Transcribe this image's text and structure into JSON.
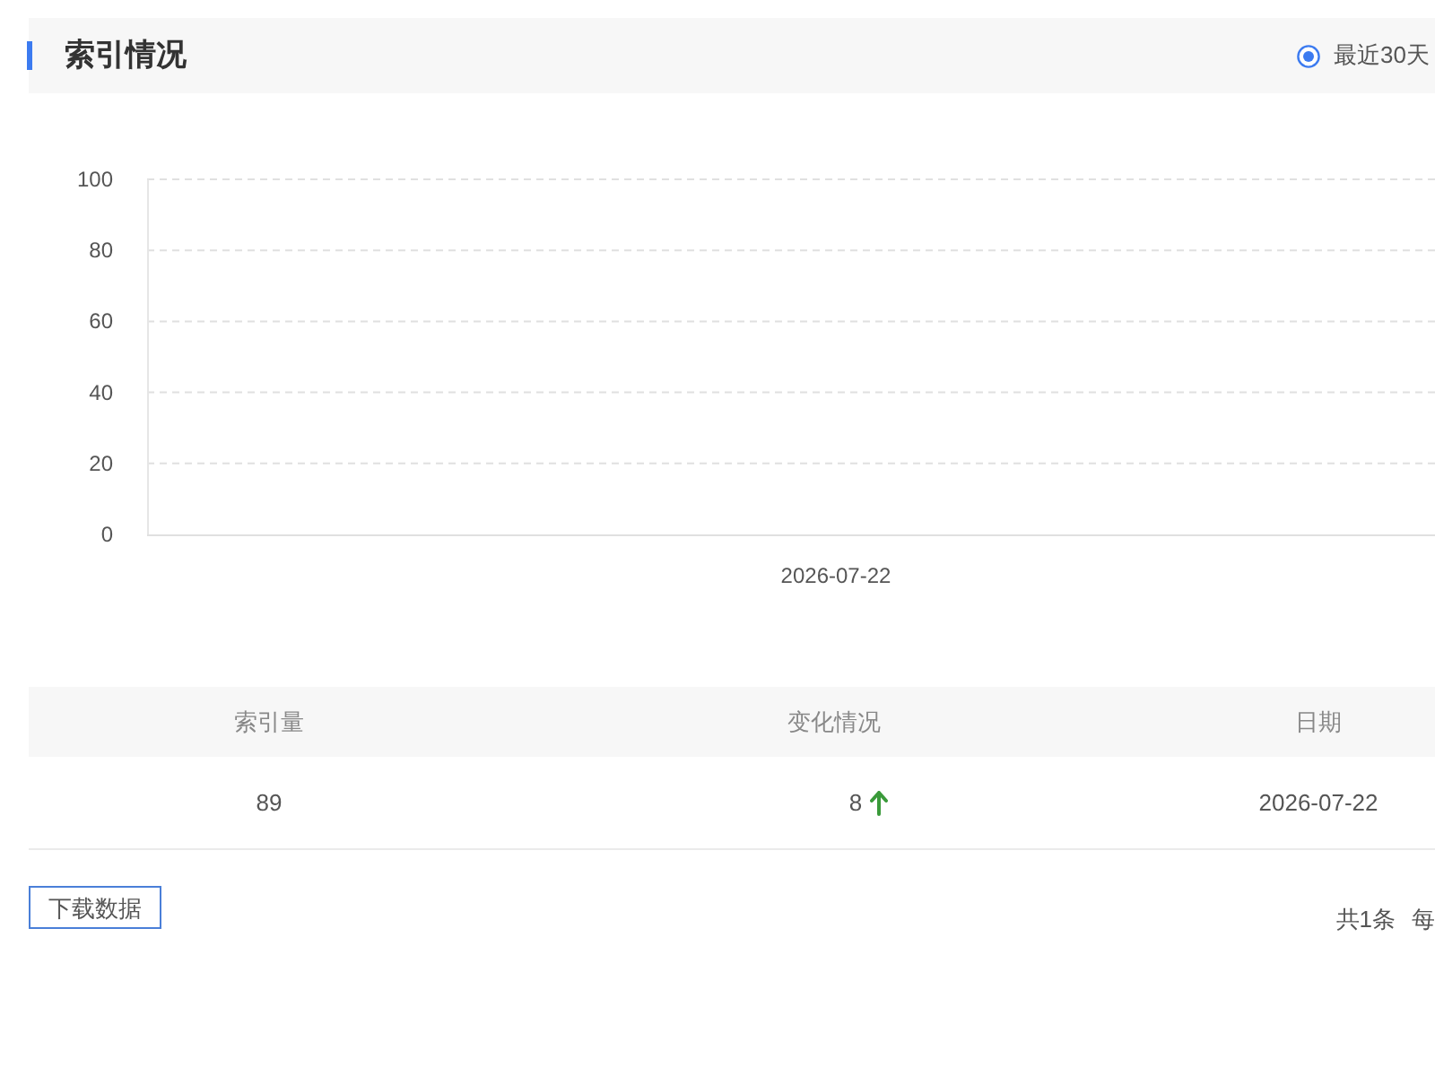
{
  "header": {
    "title": "索引情况",
    "range_options": [
      {
        "label": "最近30天",
        "selected": true
      }
    ]
  },
  "chart": {
    "chart_data": {
      "type": "line",
      "categories": [
        "2026-07-22"
      ],
      "ylim": [
        0,
        100
      ],
      "yticks": [
        0,
        20,
        40,
        60,
        80,
        100
      ],
      "grid": true
    }
  },
  "table": {
    "columns": [
      "索引量",
      "变化情况",
      "日期"
    ],
    "rows": [
      {
        "cells": [
          "89",
          "8",
          "2026-07-22"
        ],
        "rising": true
      }
    ]
  },
  "download_button": "下载数据",
  "pagination": {
    "total": "共1条",
    "page_size": "每"
  }
}
